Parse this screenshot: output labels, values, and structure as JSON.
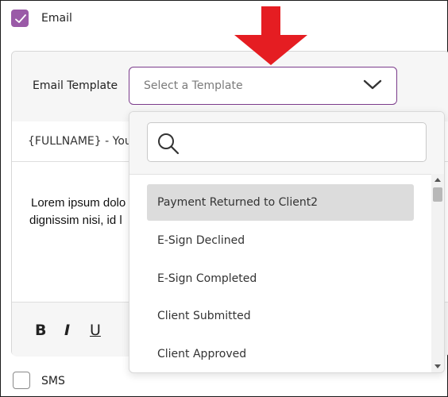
{
  "email_option": {
    "label": "Email",
    "checked": true
  },
  "sms_option": {
    "label": "SMS",
    "checked": false
  },
  "template": {
    "label": "Email Template",
    "placeholder": "Select a Template",
    "open": true
  },
  "subject": {
    "text": "{FULLNAME} - Your"
  },
  "body": {
    "lines": [
      "Lorem ipsum dolo",
      "dignissim nisi, id l"
    ]
  },
  "toolbar": {
    "bold_label": "B",
    "italic_label": "I",
    "underline_label": "U"
  },
  "dropdown": {
    "search_value": "",
    "items": [
      {
        "label": "Payment Returned to Client2",
        "highlighted": true
      },
      {
        "label": "E-Sign Declined",
        "highlighted": false
      },
      {
        "label": "E-Sign Completed",
        "highlighted": false
      },
      {
        "label": "Client Submitted",
        "highlighted": false
      },
      {
        "label": "Client Approved",
        "highlighted": false
      }
    ]
  },
  "colors": {
    "accent": "#9a5aa7",
    "select_border": "#7b3b8b",
    "arrow": "#e51d22",
    "highlight": "#dcdcdc"
  }
}
